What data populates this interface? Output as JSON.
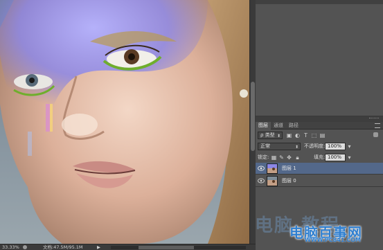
{
  "canvas": {
    "image_name": "portrait-photo"
  },
  "statusbar": {
    "zoom": "33.33%",
    "doc_info": "文档:47.5M/95.1M"
  },
  "layers_panel": {
    "tabs": [
      {
        "label": "图层"
      },
      {
        "label": "通道"
      },
      {
        "label": "路径"
      }
    ],
    "filter": {
      "label": "类型",
      "prefix": "ρ"
    },
    "blend_mode": "正常",
    "opacity_label": "不透明度:",
    "opacity_value": "100%",
    "lock_label": "锁定:",
    "fill_label": "填充:",
    "fill_value": "100%",
    "layers": [
      {
        "name": "图层 1",
        "selected": true
      },
      {
        "name": "图层 0",
        "selected": false
      }
    ]
  },
  "watermark": {
    "faint": "电脑 教程",
    "brand": "电脑百事网",
    "url": "WWW.PC841.COM"
  },
  "colors": {
    "panel_bg": "#535353",
    "selected_layer": "#53688a",
    "watermark_blue": "#2f7fd0",
    "purple_overlay": "#8c87e6"
  }
}
